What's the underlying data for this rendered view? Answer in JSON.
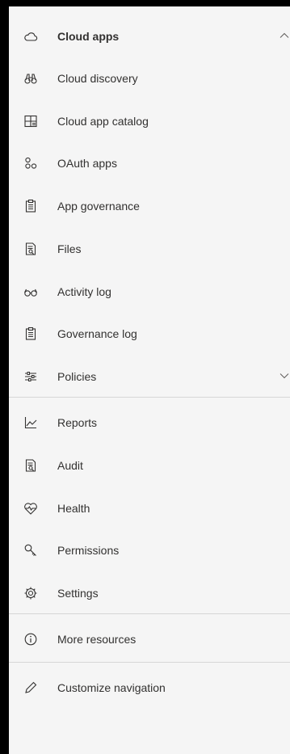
{
  "nav": {
    "cloud_apps": {
      "label": "Cloud apps",
      "icon": "cloud-icon",
      "expanded": true
    },
    "sub_items": [
      {
        "label": "Cloud discovery",
        "icon": "binoculars-icon"
      },
      {
        "label": "Cloud app catalog",
        "icon": "catalog-grid-icon"
      },
      {
        "label": "OAuth apps",
        "icon": "oauth-key-icon"
      },
      {
        "label": "App governance",
        "icon": "clipboard-icon"
      },
      {
        "label": "Files",
        "icon": "file-search-icon"
      },
      {
        "label": "Activity log",
        "icon": "glasses-icon"
      },
      {
        "label": "Governance log",
        "icon": "clipboard-icon"
      }
    ],
    "policies": {
      "label": "Policies",
      "icon": "sliders-icon",
      "expanded": false
    },
    "main_items": [
      {
        "label": "Reports",
        "icon": "line-chart-icon"
      },
      {
        "label": "Audit",
        "icon": "file-search-icon"
      },
      {
        "label": "Health",
        "icon": "heart-pulse-icon"
      },
      {
        "label": "Permissions",
        "icon": "key-icon"
      },
      {
        "label": "Settings",
        "icon": "gear-icon"
      }
    ],
    "more_resources": {
      "label": "More resources",
      "icon": "info-icon"
    },
    "customize": {
      "label": "Customize navigation",
      "icon": "pencil-icon"
    }
  }
}
